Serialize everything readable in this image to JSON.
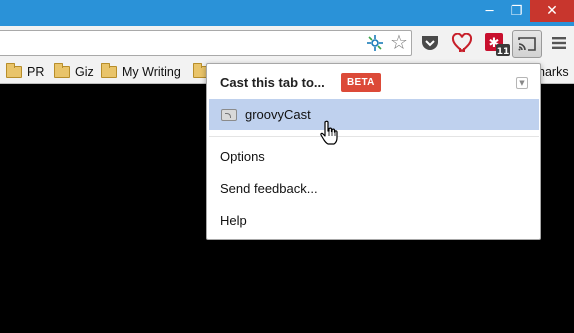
{
  "window": {
    "minimize_glyph": "─",
    "maximize_glyph": "❐",
    "close_glyph": "✕"
  },
  "toolbar": {
    "icons": [
      "pin-icon",
      "star-icon",
      "pocket-icon",
      "heart-icon",
      "lastpass-icon",
      "cast-icon",
      "menu-icon"
    ],
    "star_glyph": "☆",
    "lastpass_badge": "11"
  },
  "bookmarks": {
    "items": [
      {
        "label": "PR"
      },
      {
        "label": "Giz"
      },
      {
        "label": "My Writing"
      }
    ],
    "overflow_label": "harks"
  },
  "cast_popup": {
    "title": "Cast this tab to...",
    "badge": "BETA",
    "devices": [
      {
        "name": "groovyCast"
      }
    ],
    "menu": {
      "options": "Options",
      "feedback": "Send feedback...",
      "help": "Help"
    }
  },
  "colors": {
    "titlebar": "#2a92d8",
    "close_button": "#c8362d",
    "beta_badge": "#dc4a38",
    "selected_row": "#bfd1ee"
  }
}
